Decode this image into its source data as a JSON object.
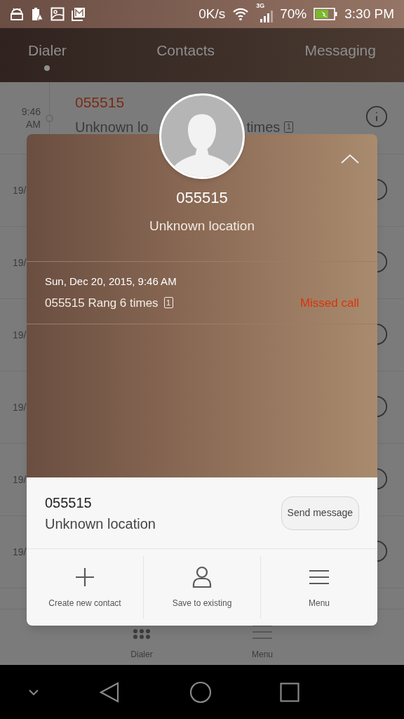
{
  "status_bar": {
    "net_speed": "0K/s",
    "network": "3G",
    "battery": "70%",
    "time": "3:30 PM"
  },
  "tabs": [
    {
      "label": "Dialer",
      "selected": true
    },
    {
      "label": "Contacts",
      "selected": false
    },
    {
      "label": "Messaging",
      "selected": false
    }
  ],
  "call_log": {
    "first": {
      "time": "9:46",
      "period": "AM",
      "number": "055515",
      "location": "Unknown lo",
      "tail": "times",
      "sim": "1"
    },
    "rows": [
      {
        "date": "19/"
      },
      {
        "date": "19/"
      },
      {
        "date": "19/"
      },
      {
        "date": "19/"
      },
      {
        "date": "19/"
      },
      {
        "date": "19/"
      }
    ]
  },
  "bottom_bar": [
    {
      "label": "Dialer",
      "kind": "dialpad"
    },
    {
      "label": "Menu",
      "kind": "menu"
    }
  ],
  "dialog": {
    "number": "055515",
    "location": "Unknown location",
    "date": "Sun, Dec 20, 2015, 9:46 AM",
    "detail": "055515 Rang 6 times",
    "sim": "1",
    "status": "Missed call",
    "contact": {
      "number": "055515",
      "location": "Unknown location"
    },
    "send_button": "Send message",
    "actions": [
      {
        "label": "Create new contact",
        "kind": "add"
      },
      {
        "label": "Save to existing",
        "kind": "person"
      },
      {
        "label": "Menu",
        "kind": "menu"
      }
    ]
  }
}
